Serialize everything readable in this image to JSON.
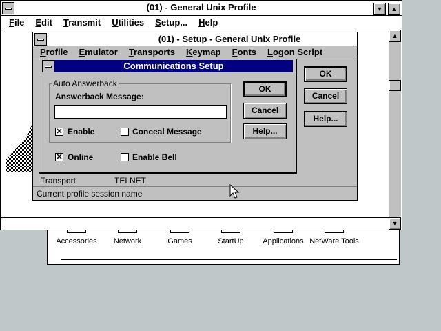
{
  "terminal_window": {
    "title": "(01) - General Unix Profile",
    "menu": [
      "File",
      "Edit",
      "Transmit",
      "Utilities",
      "Setup...",
      "Help"
    ]
  },
  "setup_window": {
    "title": "(01) - Setup - General Unix Profile",
    "menu": [
      "Profile",
      "Emulator",
      "Transports",
      "Keymap",
      "Fonts",
      "Logon Script"
    ],
    "ok_label": "OK",
    "cancel_label": "Cancel",
    "help_label": "Help...",
    "transport_label": "Transport",
    "transport_value": "TELNET",
    "status_text": "Current profile session name"
  },
  "comm_dialog": {
    "title": "Communications Setup",
    "group_label": "Auto Answerback",
    "answerback_label": "Answerback Message:",
    "answerback_value": "",
    "enable_label": "Enable",
    "conceal_label": "Conceal Message",
    "online_label": "Online",
    "bell_label": "Enable Bell",
    "ok_label": "OK",
    "cancel_label": "Cancel",
    "help_label": "Help...",
    "enable_checked": true,
    "conceal_checked": false,
    "online_checked": true,
    "bell_checked": false
  },
  "program_groups": [
    "Accessories",
    "Network",
    "Games",
    "StartUp",
    "Applications",
    "NetWare Tools"
  ],
  "colors": {
    "desktop": "#c0c7c8",
    "dialog_title": "#000080",
    "face": "#c0c0c0"
  }
}
